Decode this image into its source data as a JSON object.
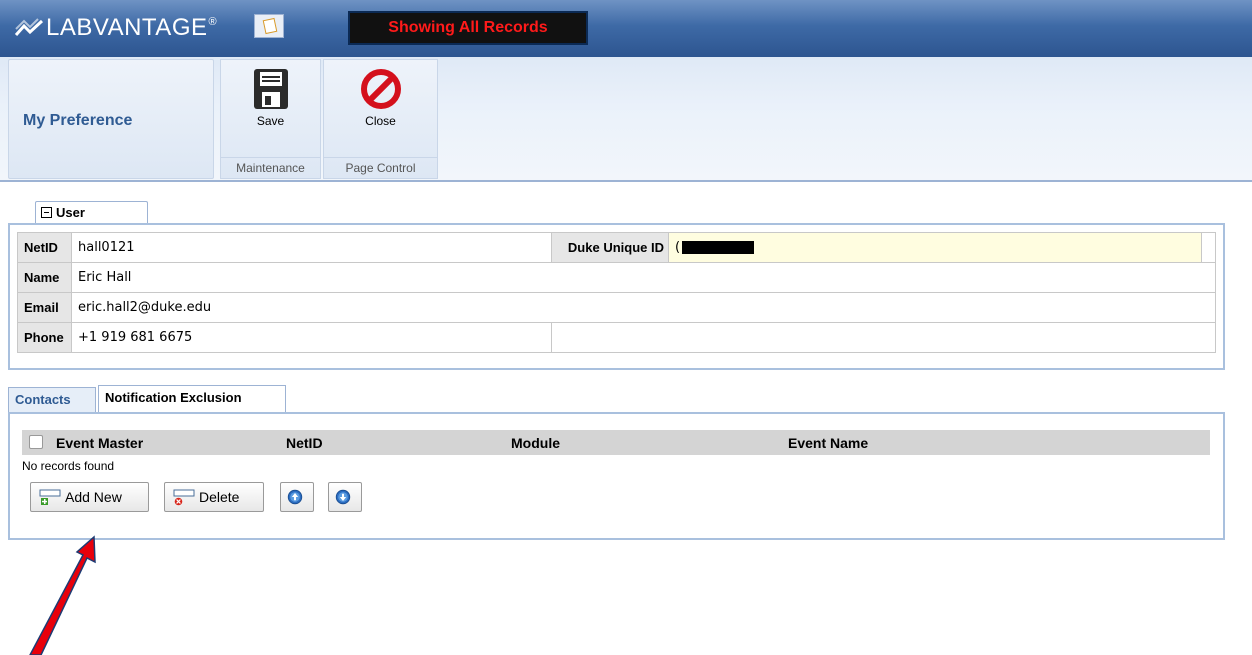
{
  "header": {
    "logo_text": "LABVANTAGE",
    "logo_reg": "®",
    "records_badge": "Showing All Records"
  },
  "ribbon": {
    "page_title": "My Preference",
    "save_label": "Save",
    "maintenance_label": "Maintenance",
    "close_label": "Close",
    "page_control_label": "Page Control"
  },
  "user_panel": {
    "tab_label": "User",
    "netid_label": "NetID",
    "netid_value": "hall0121",
    "unique_id_label": "Duke Unique ID",
    "unique_id_value": "(",
    "name_label": "Name",
    "name_value": "Eric Hall",
    "email_label": "Email",
    "email_value": "eric.hall2@duke.edu",
    "phone_label": "Phone",
    "phone_value": "+1 919 681 6675"
  },
  "tabs": {
    "contacts": "Contacts",
    "notification_exclusion": "Notification Exclusion"
  },
  "grid": {
    "columns": [
      "Event Master",
      "NetID",
      "Module",
      "Event Name"
    ],
    "empty_text": "No records found"
  },
  "buttons": {
    "add_new": "Add New",
    "delete": "Delete"
  },
  "colors": {
    "annotation_arrow": "#e8000b",
    "header_blue": "#3e6aa6",
    "badge_text": "#ff1a1a"
  }
}
